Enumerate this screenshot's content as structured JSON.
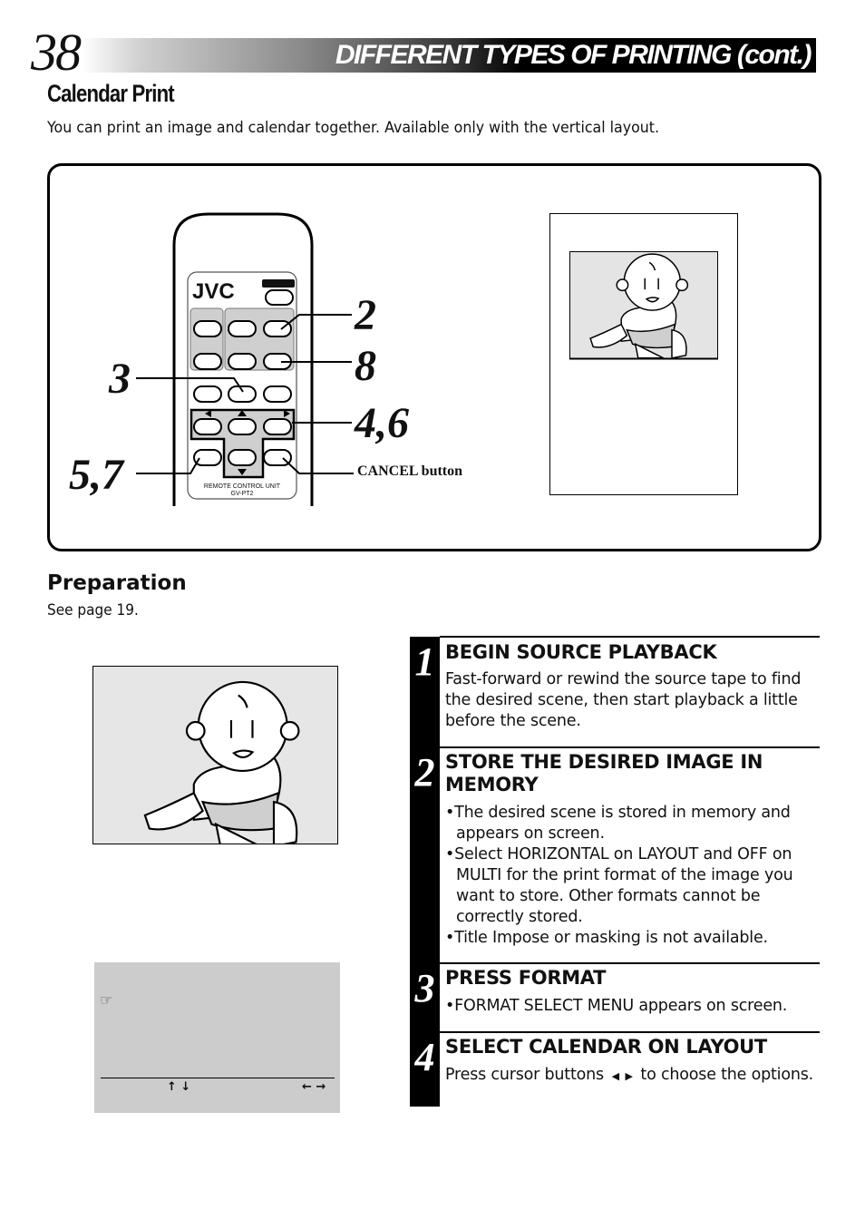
{
  "header": {
    "page_number": "38",
    "title": "DIFFERENT TYPES OF PRINTING (cont.)"
  },
  "section": {
    "heading": "Calendar Print",
    "intro": "You can print an image and calendar together. Available only with the vertical layout."
  },
  "illustration": {
    "remote": {
      "brand": "JVC",
      "label_line1": "REMOTE CONTROL UNIT",
      "label_line2": "GV-PT2"
    },
    "callouts": [
      "2",
      "8",
      "3",
      "4,6",
      "5,7"
    ],
    "cancel_label": "CANCEL button"
  },
  "preparation": {
    "heading": "Preparation",
    "text": "See page 19."
  },
  "menu_screen": {
    "pointer_icon": "pointing-hand-icon",
    "nav_up_down": "↑ ↓",
    "nav_left_right": "← →"
  },
  "steps": [
    {
      "number": "1",
      "title": "BEGIN SOURCE PLAYBACK",
      "body": "Fast-forward or rewind the source tape to find the desired scene, then start playback a little before the scene."
    },
    {
      "number": "2",
      "title": "STORE THE DESIRED IMAGE IN MEMORY",
      "bullets": [
        "•The desired scene is stored in memory and appears on screen.",
        "•Select HORIZONTAL on LAYOUT and OFF on MULTI for the print format of the image you want to store.  Other formats cannot be correctly stored.",
        "•Title Impose or masking is not available."
      ]
    },
    {
      "number": "3",
      "title": "PRESS FORMAT",
      "bullets": [
        "•FORMAT SELECT MENU appears on screen."
      ]
    },
    {
      "number": "4",
      "title": "SELECT CALENDAR ON LAYOUT",
      "body_before": "Press cursor buttons",
      "body_after": "to choose the options."
    }
  ]
}
